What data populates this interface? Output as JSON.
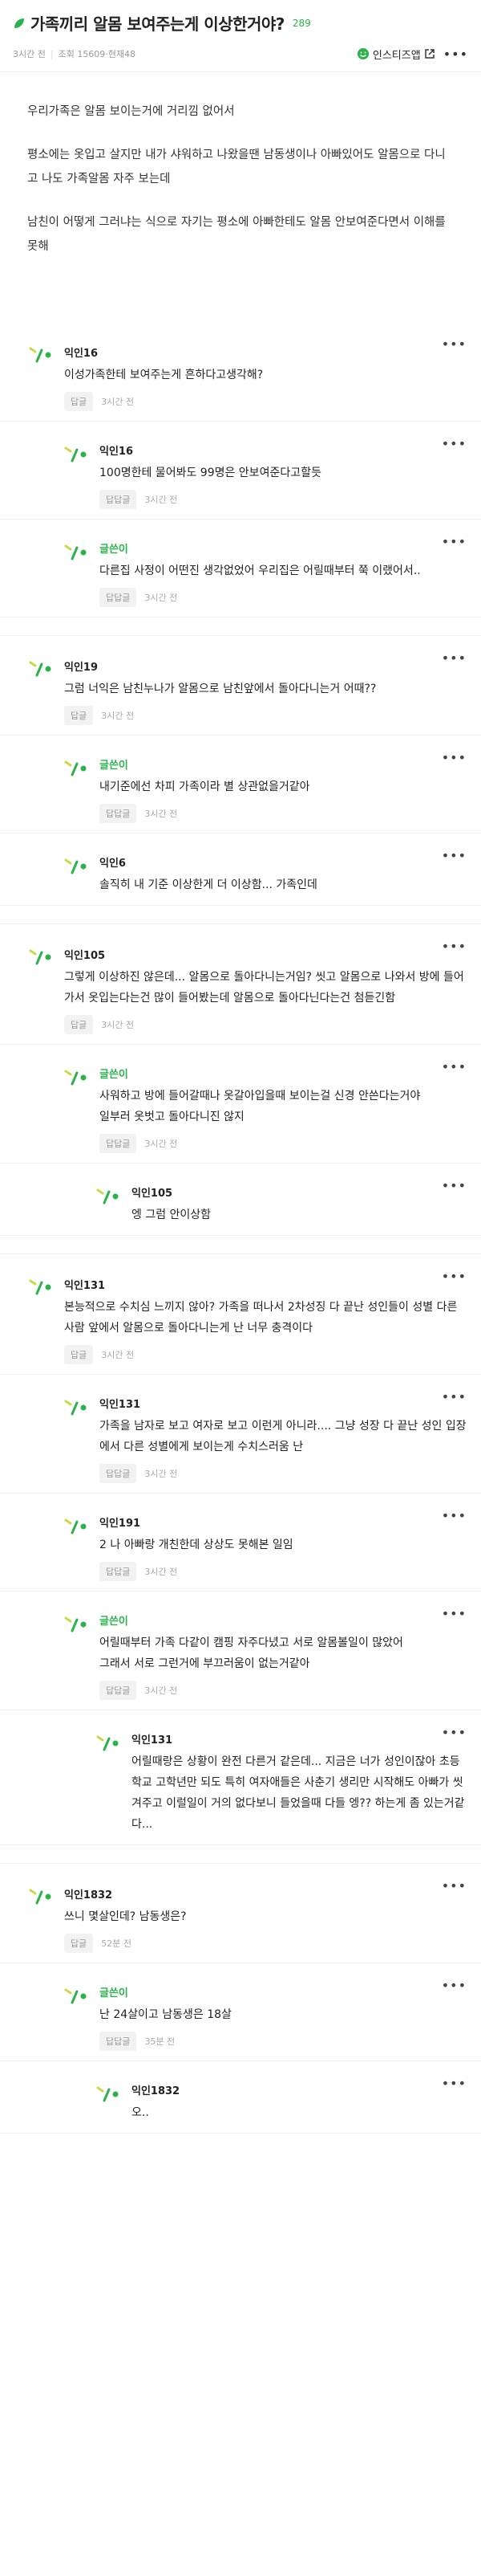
{
  "post": {
    "title": "가족끼리 알몸 보여주는게 이상한거야?",
    "count": "289",
    "age": "3시간 전",
    "views": "조회 15609",
    "current": "현재48",
    "app_label": "인스티즈앱",
    "body": [
      "우리가족은 알몸 보이는거에 거리낌 없어서",
      "평소에는 옷입고 살지만 내가 샤워하고 나왔을땐 남동생이나 아빠있어도 알몸으로 다니고 나도 가족알몸 자주 보는데",
      "남친이 어떻게 그러냐는 식으로 자기는 평소에 아빠한테도 알몸 안보여준다면서 이해를 못해"
    ]
  },
  "labels": {
    "reply": "답글",
    "reply_to_reply": "답답글"
  },
  "colors": {
    "accent": "#2bb24c"
  },
  "comments": [
    {
      "level": 0,
      "author": "익인16",
      "op": false,
      "text": "이성가족한테 보여주는게 흔하다고생각해?",
      "btn": "답글",
      "time": "3시간 전"
    },
    {
      "level": 1,
      "author": "익인16",
      "op": false,
      "text": "100명한테 물어봐도 99명은 안보여준다고할듯",
      "btn": "답답글",
      "time": "3시간 전"
    },
    {
      "level": 1,
      "author": "글쓴이",
      "op": true,
      "text": "다른집 사정이 어떤진 생각없었어 우리집은 어릴때부터 쭉 이랬어서..",
      "btn": "답답글",
      "time": "3시간 전"
    },
    {
      "level": 0,
      "author": "익인19",
      "op": false,
      "text": "그럼 너익은 남친누나가 알몸으로 남친앞에서 돌아다니는거 어때??",
      "btn": "답글",
      "time": "3시간 전"
    },
    {
      "level": 1,
      "author": "글쓴이",
      "op": true,
      "text": "내기준에선 차피 가족이라 별 상관없을거같아",
      "btn": "답답글",
      "time": "3시간 전"
    },
    {
      "level": 1,
      "author": "익인6",
      "op": false,
      "text": "솔직히 내 기준 이상한게 더 이상함... 가족인데",
      "btn": "",
      "time": ""
    },
    {
      "level": 0,
      "author": "익인105",
      "op": false,
      "text": "그렇게 이상하진 않은데... 알몸으로 돌아다니는거임? 씻고 알몸으로 나와서 방에 들어가서 옷입는다는건 많이 들어봤는데 알몸으로 돌아다닌다는건 첨듣긴함",
      "btn": "답글",
      "time": "3시간 전"
    },
    {
      "level": 1,
      "author": "글쓴이",
      "op": true,
      "text": "사워하고 방에 들어갈때나 옷갈아입을때 보이는걸 신경 안쓴다는거야\n일부러 옷벗고 돌아다니진 않지",
      "btn": "답답글",
      "time": "3시간 전"
    },
    {
      "level": 2,
      "author": "익인105",
      "op": false,
      "text": "엥 그럼 안이상함",
      "btn": "",
      "time": ""
    },
    {
      "level": 0,
      "author": "익인131",
      "op": false,
      "text": "본능적으로 수치심 느끼지 않아? 가족을 떠나서 2차성징 다 끝난 성인들이 성별 다른 사람 앞에서 알몸으로 돌아다니는게 난 너무 충격이다",
      "btn": "답글",
      "time": "3시간 전"
    },
    {
      "level": 1,
      "author": "익인131",
      "op": false,
      "text": "가족을 남자로 보고 여자로 보고 이런게 아니라.... 그냥 성장 다 끝난 성인 입장에서 다른 성별에게 보이는게 수치스러움 난",
      "btn": "답답글",
      "time": "3시간 전"
    },
    {
      "level": 1,
      "author": "익인191",
      "op": false,
      "text": "2 나 아빠랑 개친한데 상상도 못해본 일임",
      "btn": "답답글",
      "time": "3시간 전"
    },
    {
      "level": 1,
      "author": "글쓴이",
      "op": true,
      "text": "어릴때부터 가족 다같이 캠핑 자주다녔고 서로 알몸볼일이 많았어\n그래서 서로 그런거에 부끄러움이 없는거같아",
      "btn": "답답글",
      "time": "3시간 전"
    },
    {
      "level": 2,
      "author": "익인131",
      "op": false,
      "text": "어릴때랑은 상황이 완전 다른거 같은데... 지금은 너가 성인이잖아 초등학교 고학년만 되도 특히 여자애들은 사춘기 생리만 시작해도 아빠가 씻겨주고 이럴일이 거의 없다보니 들었을때 다들 엥?? 하는게 좀 있는거같다...",
      "btn": "",
      "time": ""
    },
    {
      "level": 0,
      "author": "익인1832",
      "op": false,
      "text": "쓰니 몇살인데? 남동생은?",
      "btn": "답글",
      "time": "52분 전"
    },
    {
      "level": 1,
      "author": "글쓴이",
      "op": true,
      "text": "난 24살이고 남동생은 18살",
      "btn": "답답글",
      "time": "35분 전"
    },
    {
      "level": 2,
      "author": "익인1832",
      "op": false,
      "text": "오..",
      "btn": "",
      "time": ""
    }
  ]
}
